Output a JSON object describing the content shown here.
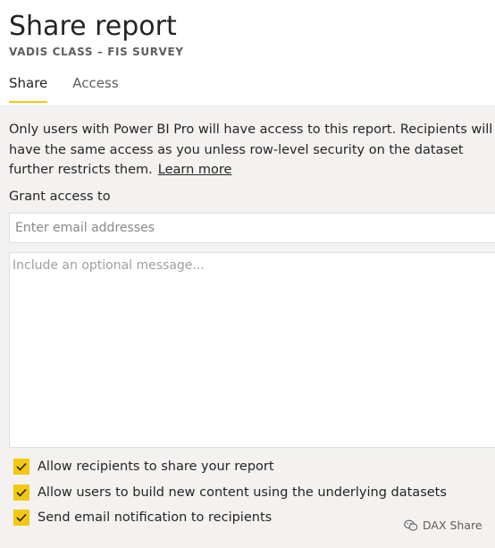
{
  "title": "Share report",
  "subtitle": "VADIS CLASS – FIS SURVEY",
  "tabs": [
    {
      "label": "Share",
      "active": true
    },
    {
      "label": "Access",
      "active": false
    }
  ],
  "description": "Only users with Power BI Pro will have access to this report. Recipients will have the same access as you unless row-level security on the dataset further restricts them.",
  "learn_more": "Learn more",
  "grant_label": "Grant access to",
  "email_placeholder": "Enter email addresses",
  "message_placeholder": "Include an optional message...",
  "options": [
    {
      "label": "Allow recipients to share your report",
      "checked": true
    },
    {
      "label": "Allow users to build new content using the underlying datasets",
      "checked": true
    },
    {
      "label": "Send email notification to recipients",
      "checked": true
    }
  ],
  "watermark": "DAX Share",
  "colors": {
    "accent": "#f2c811",
    "background": "#f3f2f1",
    "text": "#252423"
  },
  "icons": {
    "check": "checkmark-icon",
    "watermark": "wechat-icon"
  }
}
